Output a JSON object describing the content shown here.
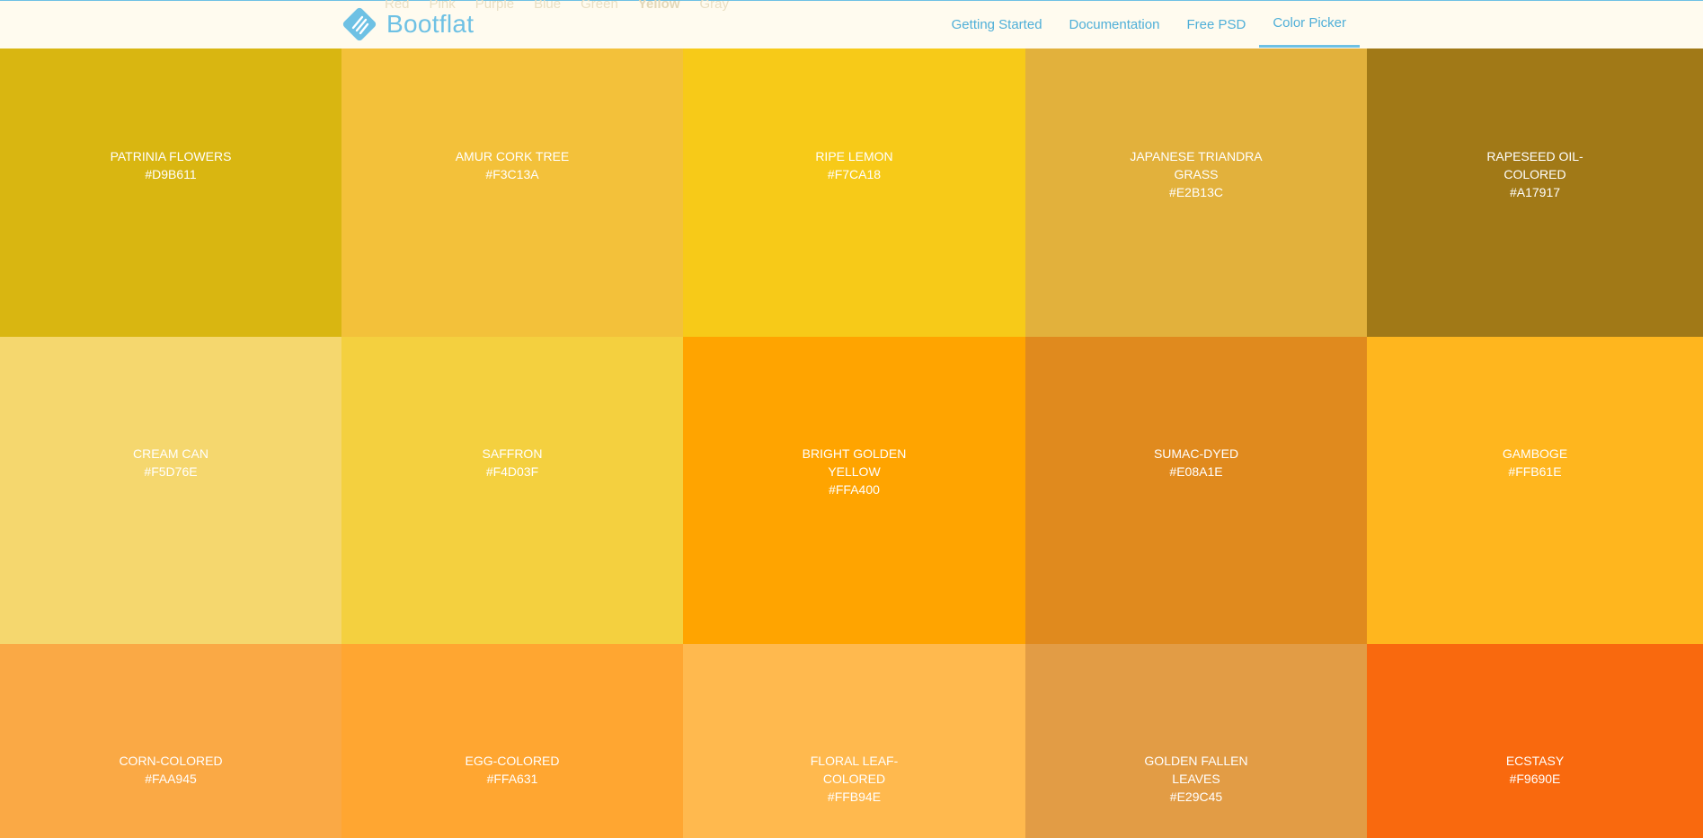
{
  "nav": {
    "brand": "Bootflat",
    "ghost_menu": [
      "Red",
      "Pink",
      "Purple",
      "Blue",
      "Green",
      "Yellow",
      "Gray"
    ],
    "links": [
      {
        "label": "Getting Started"
      },
      {
        "label": "Documentation"
      },
      {
        "label": "Free PSD"
      },
      {
        "label": "Color Picker",
        "active": true
      }
    ],
    "brand_color": "#6ec1e4"
  },
  "swatches": [
    {
      "name": "PATRINIA FLOWERS",
      "hex": "#D9B611"
    },
    {
      "name": "AMUR CORK TREE",
      "hex": "#F3C13A"
    },
    {
      "name": "RIPE LEMON",
      "hex": "#F7CA18"
    },
    {
      "name": "JAPANESE TRIANDRA GRASS",
      "hex": "#E2B13C"
    },
    {
      "name": "RAPESEED OIL-COLORED",
      "hex": "#A17917"
    },
    {
      "name": "CREAM CAN",
      "hex": "#F5D76E"
    },
    {
      "name": "SAFFRON",
      "hex": "#F4D03F"
    },
    {
      "name": "BRIGHT GOLDEN YELLOW",
      "hex": "#FFA400"
    },
    {
      "name": "SUMAC-DYED",
      "hex": "#E08A1E"
    },
    {
      "name": "GAMBOGE",
      "hex": "#FFB61E"
    },
    {
      "name": "CORN-COLORED",
      "hex": "#FAA945"
    },
    {
      "name": "EGG-COLORED",
      "hex": "#FFA631"
    },
    {
      "name": "FLORAL LEAF-COLORED",
      "hex": "#FFB94E"
    },
    {
      "name": "GOLDEN FALLEN LEAVES",
      "hex": "#E29C45"
    },
    {
      "name": "ECSTASY",
      "hex": "#F9690E"
    }
  ]
}
